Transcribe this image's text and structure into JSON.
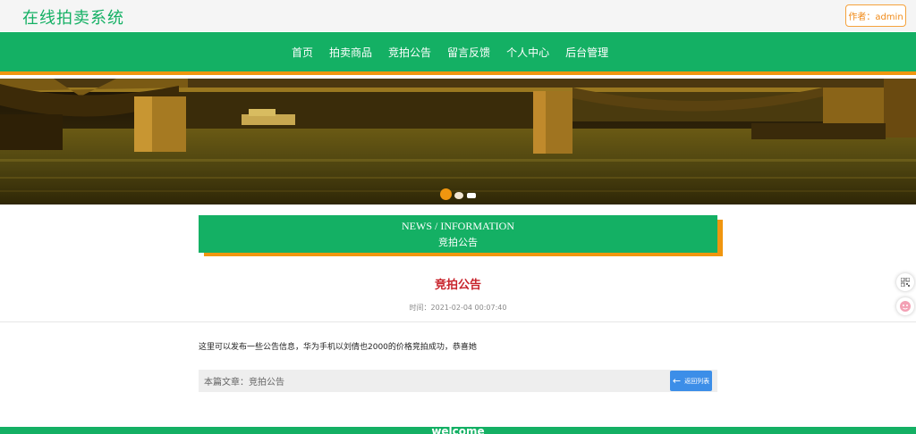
{
  "header": {
    "site_title": "在线拍卖系统",
    "author_label": "作者：admin"
  },
  "nav": {
    "items": [
      {
        "label": "首页"
      },
      {
        "label": "拍卖商品"
      },
      {
        "label": "竞拍公告"
      },
      {
        "label": "留言反馈"
      },
      {
        "label": "个人中心"
      },
      {
        "label": "后台管理"
      }
    ]
  },
  "banner": {
    "slide_count": 3,
    "active_slide": 1
  },
  "section": {
    "title_en": "NEWS / INFORMATION",
    "title_zh": "竞拍公告"
  },
  "article": {
    "title": "竞拍公告",
    "time": "时间：2021-02-04 00:07:40",
    "body": "这里可以发布一些公告信息，华为手机以刘倩也2000的价格竞拍成功，恭喜她"
  },
  "footer_nav": {
    "current_label": "本篇文章：竞拍公告",
    "back_label": "返回列表"
  },
  "bottom": {
    "text": "welcome"
  },
  "colors": {
    "primary": "#14b064",
    "accent": "#f0960f",
    "title_red": "#c8242c",
    "button_blue": "#3c8ee8"
  }
}
